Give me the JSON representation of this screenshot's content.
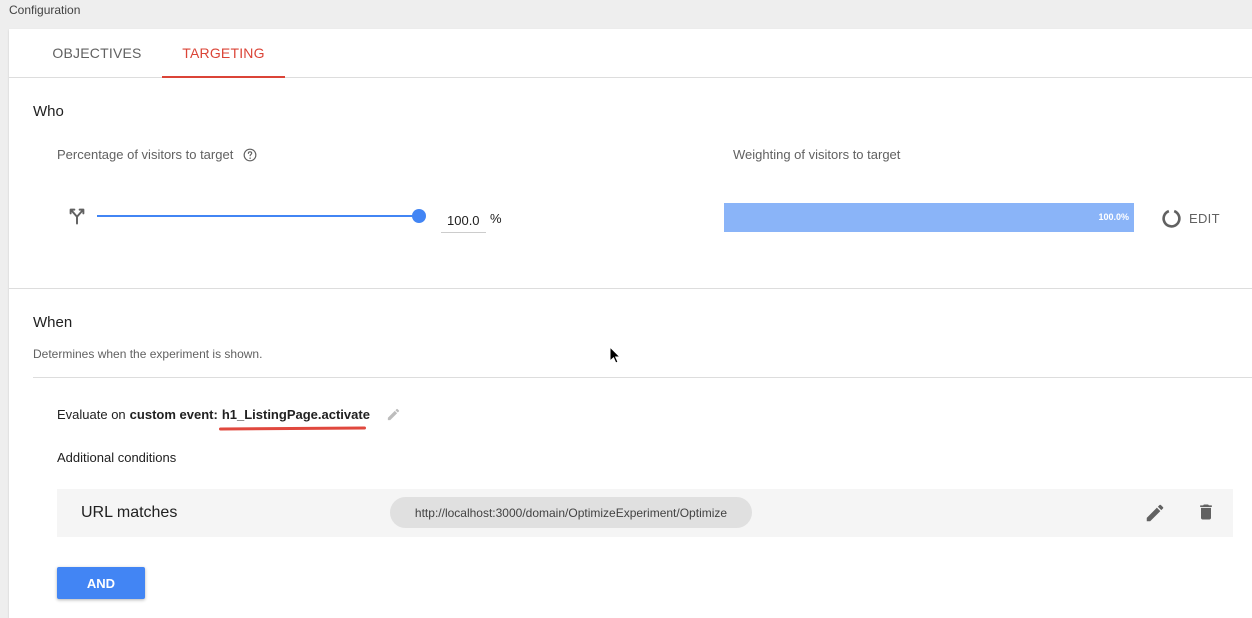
{
  "header": {
    "title": "Configuration"
  },
  "tabs": [
    {
      "label": "OBJECTIVES",
      "active": false
    },
    {
      "label": "TARGETING",
      "active": true
    }
  ],
  "who": {
    "title": "Who",
    "percentage_label": "Percentage of visitors to target",
    "percentage_value": "100.0",
    "percentage_unit": "%",
    "slider_fraction": 1.0,
    "weighting_label": "Weighting of visitors to target",
    "weighting_bar_text": "100.0%",
    "weighting_fraction": 1.0,
    "edit_label": "EDIT"
  },
  "when": {
    "title": "When",
    "description": "Determines when the experiment is shown.",
    "evaluate_prefix": "Evaluate on",
    "evaluate_type": "custom event:",
    "event_name": "h1_ListingPage.activate",
    "additional_conditions_label": "Additional conditions",
    "conditions": [
      {
        "label": "URL matches",
        "value": "http://localhost:3000/domain/OptimizeExperiment/Optimize"
      }
    ],
    "and_button": "AND"
  },
  "colors": {
    "accent_red": "#db4437",
    "accent_blue": "#4285f4",
    "weight_bar": "#8ab4f8"
  },
  "icons": [
    "help-circle-icon",
    "split-icon",
    "donut-chart-icon",
    "pencil-icon",
    "trash-icon",
    "mouse-cursor-icon"
  ]
}
